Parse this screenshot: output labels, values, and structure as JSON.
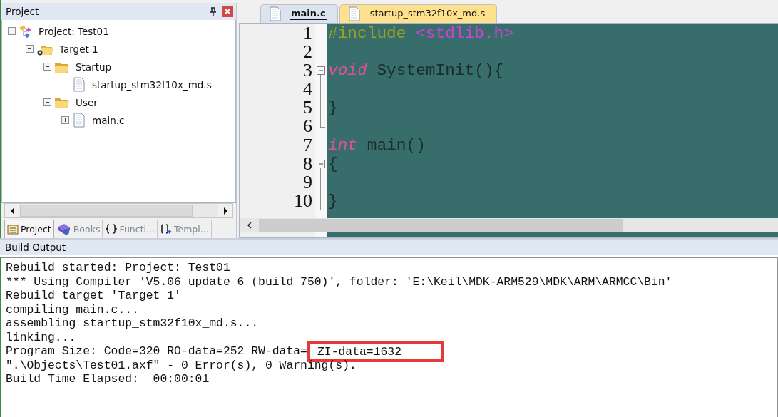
{
  "project_panel": {
    "title": "Project",
    "tree": [
      {
        "label": "Project: Test01",
        "kind": "project",
        "expanded": true,
        "children": [
          {
            "label": "Target 1",
            "kind": "target",
            "expanded": true,
            "children": [
              {
                "label": "Startup",
                "kind": "folder",
                "expanded": true,
                "children": [
                  {
                    "label": "startup_stm32f10x_md.s",
                    "kind": "file"
                  }
                ]
              },
              {
                "label": "User",
                "kind": "folder",
                "expanded": true,
                "children": [
                  {
                    "label": "main.c",
                    "kind": "file",
                    "expanded": false
                  }
                ]
              }
            ]
          }
        ]
      }
    ],
    "tabs": [
      {
        "label": "Project",
        "kind": "project",
        "selected": true
      },
      {
        "label": "Books",
        "kind": "books",
        "selected": false
      },
      {
        "label": "Functi...",
        "kind": "functions",
        "selected": false
      },
      {
        "label": "Templ...",
        "kind": "templates",
        "selected": false
      }
    ]
  },
  "editor": {
    "tabs": [
      {
        "label": "main.c",
        "selected": true
      },
      {
        "label": "startup_stm32f10x_md.s",
        "selected": false
      }
    ],
    "lines": [
      {
        "number": "1",
        "kind": "plain",
        "code": [
          {
            "text": "#include ",
            "kind": "preprocessor"
          },
          {
            "text": "<stdlib.h>",
            "kind": "header"
          }
        ]
      },
      {
        "number": "2",
        "kind": "plain"
      },
      {
        "number": "3",
        "kind": "fold_start",
        "code": [
          {
            "text": "void",
            "kind": "keyword"
          },
          {
            "text": " SystemInit(){",
            "kind": "plain"
          }
        ]
      },
      {
        "number": "4",
        "kind": "fold_body"
      },
      {
        "number": "5",
        "kind": "fold_body",
        "code": [
          {
            "text": "}",
            "kind": "plain"
          }
        ]
      },
      {
        "number": "6",
        "kind": "fold_end"
      },
      {
        "number": "7",
        "kind": "plain",
        "code": [
          {
            "text": "int",
            "kind": "keyword"
          },
          {
            "text": " main()",
            "kind": "plain"
          }
        ]
      },
      {
        "number": "8",
        "kind": "fold_start",
        "code": [
          {
            "text": "{",
            "kind": "plain"
          }
        ]
      },
      {
        "number": "9",
        "kind": "fold_body"
      },
      {
        "number": "10",
        "kind": "fold_body",
        "code": [
          {
            "text": "}",
            "kind": "plain"
          }
        ]
      }
    ]
  },
  "build_output": {
    "title": "Build Output",
    "lines": [
      [
        {
          "text": "Rebuild started: Project: Test01",
          "highlighted": false
        }
      ],
      [
        {
          "text": "*** Using Compiler 'V5.06 update 6 (build 750)', folder: 'E:\\Keil\\MDK-ARM529\\MDK\\ARM\\ARMCC\\Bin'",
          "highlighted": false
        }
      ],
      [
        {
          "text": "Rebuild target 'Target 1'",
          "highlighted": false
        }
      ],
      [
        {
          "text": "compiling main.c...",
          "highlighted": false
        }
      ],
      [
        {
          "text": "assembling startup_stm32f10x_md.s...",
          "highlighted": false
        }
      ],
      [
        {
          "text": "linking...",
          "highlighted": false
        }
      ],
      [
        {
          "text": "Program Size: Code=320 RO-data=252 RW-data=",
          "highlighted": false
        },
        {
          "text": "ZI-data=1632",
          "highlighted": true
        }
      ],
      [
        {
          "text": "\".\\Objects\\Test01.axf\" - 0 Error(s), 0 Warning(s).",
          "highlighted": false
        }
      ],
      [
        {
          "text": "Build Time Elapsed:  00:00:01",
          "highlighted": false
        }
      ]
    ]
  }
}
